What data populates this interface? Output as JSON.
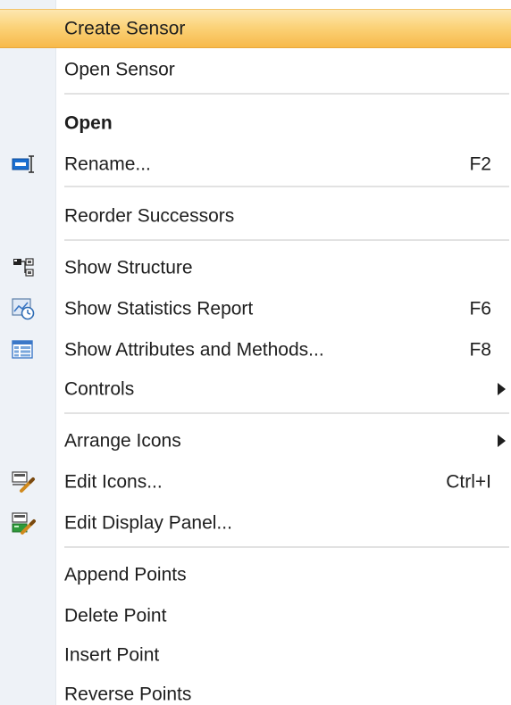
{
  "menu": {
    "items": [
      {
        "label": "Create Sensor",
        "highlighted": true
      },
      {
        "label": "Open Sensor"
      },
      {
        "label": "Open",
        "bold": true
      },
      {
        "label": "Rename...",
        "shortcut": "F2",
        "icon": "rename-icon"
      },
      {
        "label": "Reorder Successors"
      },
      {
        "label": "Show Structure",
        "icon": "structure-icon"
      },
      {
        "label": "Show Statistics Report",
        "shortcut": "F6",
        "icon": "statistics-report-icon"
      },
      {
        "label": "Show Attributes and Methods...",
        "shortcut": "F8",
        "icon": "attributes-table-icon"
      },
      {
        "label": "Controls",
        "submenu": true
      },
      {
        "label": "Arrange Icons",
        "submenu": true
      },
      {
        "label": "Edit Icons...",
        "shortcut": "Ctrl+I",
        "icon": "edit-icons-icon"
      },
      {
        "label": "Edit Display Panel...",
        "icon": "edit-display-panel-icon"
      },
      {
        "label": "Append Points"
      },
      {
        "label": "Delete Point"
      },
      {
        "label": "Insert Point"
      },
      {
        "label": "Reverse Points"
      }
    ]
  },
  "colors": {
    "highlight_top": "#fde7b0",
    "highlight_bottom": "#f7b94a",
    "icon_strip": "#eef2f7",
    "separator": "#e2e2e2",
    "text": "#1e1e1e"
  }
}
